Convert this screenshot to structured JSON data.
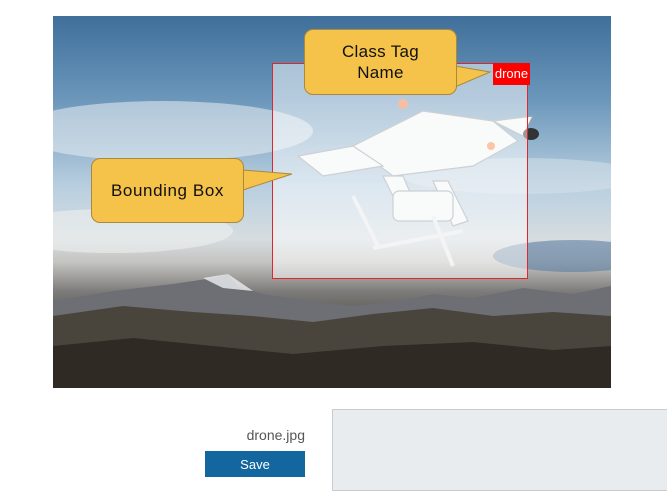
{
  "image": {
    "filename": "drone.jpg",
    "annotation": {
      "class_tag": "drone"
    }
  },
  "callouts": {
    "class_tag": {
      "line1": "Class Tag",
      "line2": "Name"
    },
    "bounding_box": {
      "label": "Bounding Box"
    }
  },
  "actions": {
    "save_label": "Save"
  },
  "colors": {
    "bbox_border": "#e0262c",
    "tag_background": "#ff0000",
    "callout_fill": "#f5c24a",
    "save_button": "#13679e",
    "panel": "#e9ecef"
  }
}
